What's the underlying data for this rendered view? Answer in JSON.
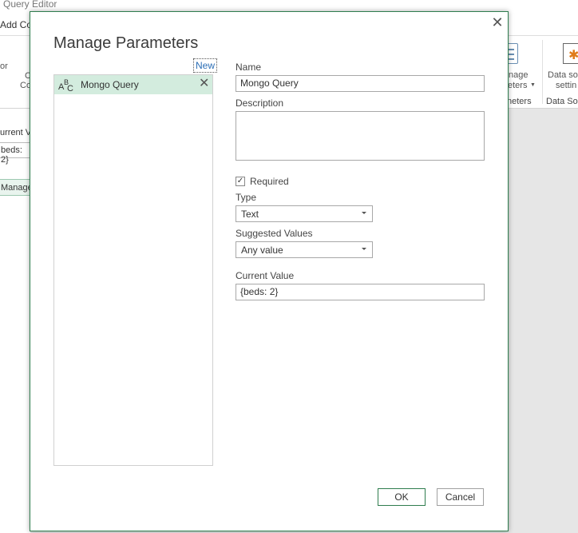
{
  "background": {
    "window_title": "Query Editor",
    "menu_item": "Add Col",
    "ribbon": {
      "left_text_1": "or",
      "left_text_2": "C",
      "left_text_3": "Co",
      "params_button_line1": "nage",
      "params_button_line2": "eters",
      "params_group_label": "neters",
      "ds_button_line1": "Data so",
      "ds_button_line2": "settin",
      "ds_group_label": "Data So"
    },
    "current_value_label": "urrent V",
    "current_value": "beds: 2}",
    "manage_button": "Manage"
  },
  "dialog": {
    "title": "Manage Parameters",
    "close_glyph": "✕",
    "new_link": "New",
    "parameters": [
      {
        "name": "Mongo Query",
        "type_icon": "abc-text-icon",
        "selected": true
      }
    ],
    "form": {
      "name_label": "Name",
      "name_value": "Mongo Query",
      "description_label": "Description",
      "description_value": "",
      "required_label": "Required",
      "required_checked": true,
      "type_label": "Type",
      "type_value": "Text",
      "suggested_label": "Suggested Values",
      "suggested_value": "Any value",
      "current_value_label": "Current Value",
      "current_value": "{beds: 2}"
    },
    "buttons": {
      "ok": "OK",
      "cancel": "Cancel"
    },
    "accent_color": "#2f7d4e",
    "selection_color": "#d3ecde"
  }
}
